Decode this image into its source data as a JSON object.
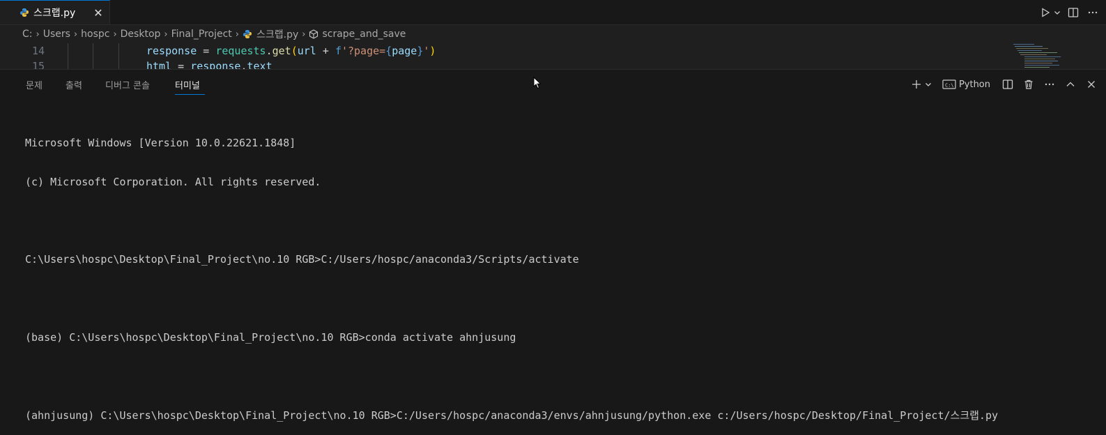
{
  "editor": {
    "tab": {
      "label": "스크랩.py",
      "close": "✕"
    },
    "breadcrumb": [
      "C:",
      "Users",
      "hospc",
      "Desktop",
      "Final_Project",
      "스크랩.py",
      "scrape_and_save"
    ],
    "lines": [
      {
        "number": "14",
        "tokens": [
          {
            "t": "response",
            "c": "#9cdcfe"
          },
          {
            "t": " = ",
            "c": "#d4d4d4"
          },
          {
            "t": "requests",
            "c": "#4ec9b0"
          },
          {
            "t": ".",
            "c": "#d4d4d4"
          },
          {
            "t": "get",
            "c": "#dcdcaa"
          },
          {
            "t": "(",
            "c": "#ffd700"
          },
          {
            "t": "url",
            "c": "#9cdcfe"
          },
          {
            "t": " + ",
            "c": "#d4d4d4"
          },
          {
            "t": "f",
            "c": "#569cd6"
          },
          {
            "t": "'?page=",
            "c": "#ce9178"
          },
          {
            "t": "{",
            "c": "#569cd6"
          },
          {
            "t": "page",
            "c": "#9cdcfe"
          },
          {
            "t": "}",
            "c": "#569cd6"
          },
          {
            "t": "'",
            "c": "#ce9178"
          },
          {
            "t": ")",
            "c": "#ffd700"
          }
        ]
      },
      {
        "number": "15",
        "tokens": [
          {
            "t": "html",
            "c": "#9cdcfe"
          },
          {
            "t": " = ",
            "c": "#d4d4d4"
          },
          {
            "t": "response",
            "c": "#9cdcfe"
          },
          {
            "t": ".",
            "c": "#d4d4d4"
          },
          {
            "t": "text",
            "c": "#9cdcfe"
          }
        ]
      }
    ]
  },
  "panel": {
    "tabs": [
      "문제",
      "출력",
      "디버그 콘솔",
      "터미널"
    ],
    "active_tab": "터미널",
    "terminal_profile": "Python"
  },
  "terminal": {
    "lines": [
      "Microsoft Windows [Version 10.0.22621.1848]",
      "(c) Microsoft Corporation. All rights reserved.",
      "",
      "C:\\Users\\hospc\\Desktop\\Final_Project\\no.10 RGB>C:/Users/hospc/anaconda3/Scripts/activate",
      "",
      "(base) C:\\Users\\hospc\\Desktop\\Final_Project\\no.10 RGB>conda activate ahnjusung",
      "",
      "(ahnjusung) C:\\Users\\hospc\\Desktop\\Final_Project\\no.10 RGB>C:/Users/hospc/anaconda3/envs/ahnjusung/python.exe c:/Users/hospc/Desktop/Final_Project/스크랩.py"
    ]
  },
  "icons": {
    "run": "run-icon",
    "run_menu": "chevron-down-icon",
    "split": "split-editor-icon",
    "more": "more-icon",
    "add_terminal": "plus-icon",
    "terminal_menu": "chevron-down-icon",
    "terminal_profile": "terminal-icon",
    "split_terminal": "split-terminal-icon",
    "kill": "trash-icon",
    "maximize": "chevron-up-icon",
    "close": "close-icon"
  },
  "colors": {
    "accent": "#0078d4",
    "background": "#181818",
    "editor_bg": "#1f1f1f"
  }
}
